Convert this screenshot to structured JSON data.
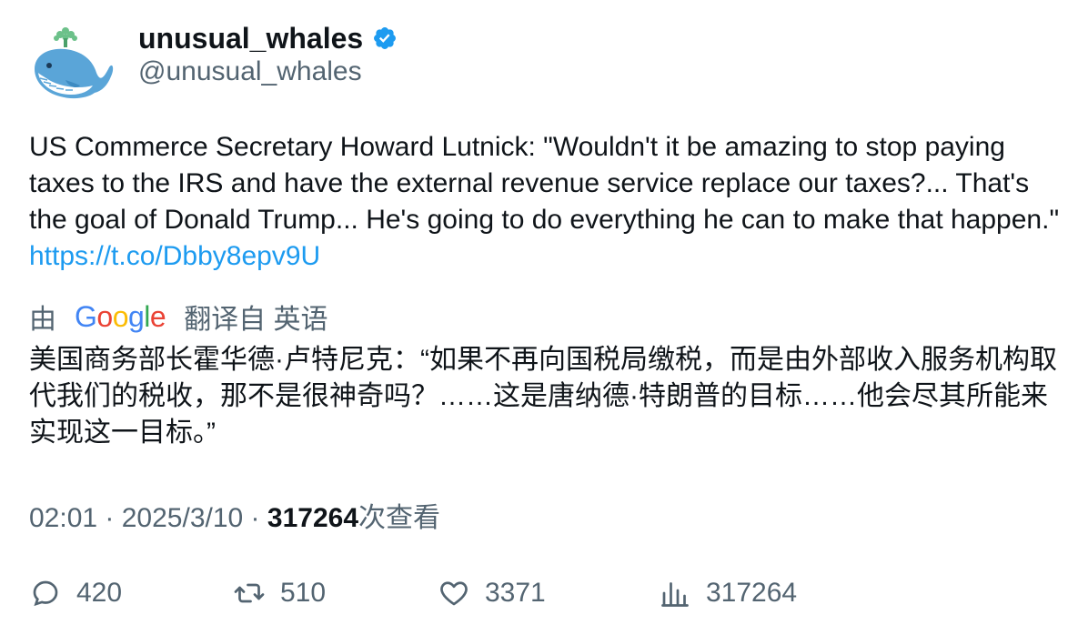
{
  "author": {
    "display_name": "unusual_whales",
    "handle": "@unusual_whales",
    "verified": true,
    "avatar_icon": "whale-avatar-icon"
  },
  "tweet": {
    "text": "US Commerce Secretary Howard Lutnick: \"Wouldn't it be amazing to stop paying taxes to the IRS and have the external revenue service replace our taxes?... That's the goal of Donald Trump... He's going to do everything he can to make that happen.\" ",
    "link": "https://t.co/Dbby8epv9U"
  },
  "translation": {
    "prefix": "由",
    "provider": "Google",
    "suffix": "翻译自 英语",
    "text": "美国商务部长霍华德·卢特尼克：“如果不再向国税局缴税，而是由外部收入服务机构取代我们的税收，那不是很神奇吗？……这是唐纳德·特朗普的目标……他会尽其所能来实现这一目标。”"
  },
  "meta": {
    "time": "02:01",
    "separator": " · ",
    "date": "2025/3/10",
    "views_count": "317264",
    "views_label": "次查看"
  },
  "actions": {
    "replies": "420",
    "retweets": "510",
    "likes": "3371",
    "views": "317264"
  },
  "colors": {
    "link": "#1d9bf0",
    "secondary_text": "#536471",
    "primary_text": "#0f1419",
    "verified": "#1d9bf0"
  }
}
